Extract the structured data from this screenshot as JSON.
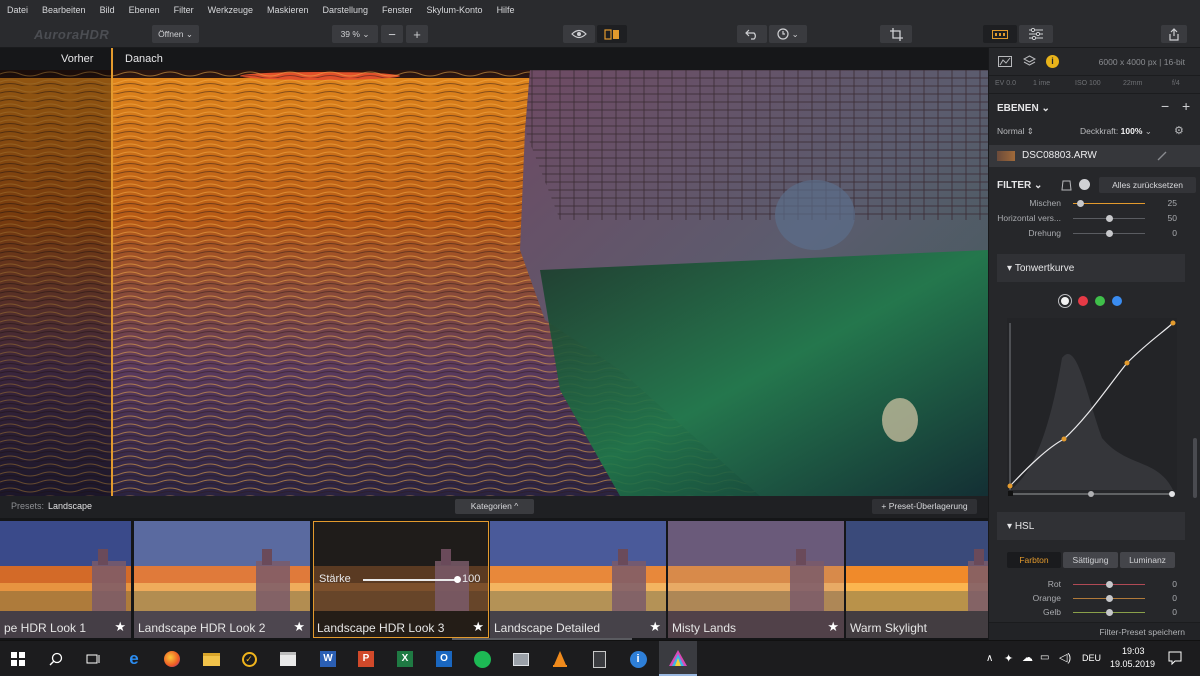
{
  "menubar": {
    "items": [
      "Datei",
      "Bearbeiten",
      "Bild",
      "Ebenen",
      "Filter",
      "Werkzeuge",
      "Maskieren",
      "Darstellung",
      "Fenster",
      "Skylum-Konto",
      "Hilfe"
    ]
  },
  "toolbar": {
    "logo": "AuroraHDR",
    "open_label": "Öffnen",
    "zoom_label": "39 %"
  },
  "canvas": {
    "before_label": "Vorher",
    "after_label": "Danach"
  },
  "presets": {
    "prefix": "Presets:",
    "category": "Landscape",
    "categories_button": "Kategorien ^",
    "overlay_button": "+ Preset-Überlagerung",
    "strength_label": "Stärke",
    "strength_value": "100",
    "strength_fraction": 1.0,
    "items": [
      {
        "label": "pe HDR Look 1",
        "favorite": true,
        "selected": false
      },
      {
        "label": "Landscape HDR Look 2",
        "favorite": true,
        "selected": false
      },
      {
        "label": "Landscape HDR Look 3",
        "favorite": true,
        "selected": true
      },
      {
        "label": "Landscape Detailed",
        "favorite": true,
        "selected": false
      },
      {
        "label": "Misty Lands",
        "favorite": true,
        "selected": false
      },
      {
        "label": "Warm Skylight",
        "favorite": false,
        "selected": false
      }
    ]
  },
  "sidepanel": {
    "image_size": "6000 x 4000 px | 16-bit",
    "exif": [
      "EV 0.0",
      "1 ime",
      "ISO 100",
      "22mm",
      "f/4"
    ],
    "layers_title": "EBENEN",
    "blend_mode": "Normal",
    "opacity_label": "Deckkraft:",
    "opacity_value": "100%",
    "layer_name": "DSC08803.ARW",
    "filter_title": "FILTER",
    "reset_all": "Alles zurücksetzen",
    "top_sliders": [
      {
        "label": "Mischen",
        "value": "25",
        "fraction": 0.1
      },
      {
        "label": "Horizontal vers...",
        "value": "50",
        "fraction": 0.5
      },
      {
        "label": "Drehung",
        "value": "0",
        "fraction": 0.5
      }
    ],
    "curve_title": "Tonwertkurve",
    "curve_channels": [
      "white",
      "red",
      "green",
      "blue"
    ],
    "hsl_title": "HSL",
    "hsl_tabs": [
      "Farbton",
      "Sättigung",
      "Luminanz"
    ],
    "hsl_sliders": [
      {
        "label": "Rot",
        "value": "0",
        "fraction": 0.5
      },
      {
        "label": "Orange",
        "value": "0",
        "fraction": 0.5
      },
      {
        "label": "Gelb",
        "value": "0",
        "fraction": 0.5
      }
    ],
    "save_preset": "Filter-Preset speichern"
  },
  "taskbar": {
    "lang": "DEU",
    "time": "19:03",
    "date": "19.05.2019"
  },
  "colors": {
    "accent": "#e39a2d",
    "panel": "#26272a",
    "curve_point": "#e39a2d"
  }
}
